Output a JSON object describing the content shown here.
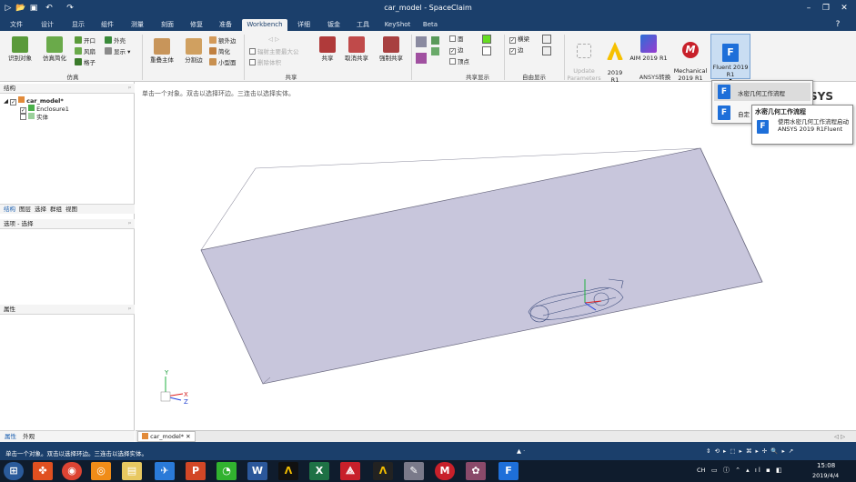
{
  "window": {
    "title": "car_model - SpaceClaim",
    "min": "–",
    "restore": "❐",
    "close": "✕",
    "help": "?"
  },
  "menu": {
    "tabs": [
      "文件",
      "设计",
      "显示",
      "组件",
      "测量",
      "刻面",
      "修复",
      "准备",
      "Workbench",
      "详细",
      "钣金",
      "工具",
      "KeyShot",
      "Beta"
    ],
    "active": "Workbench"
  },
  "ribbon": {
    "sim": {
      "identify": "识别对象",
      "simplify": "仿真简化",
      "opening": "开口",
      "shell": "外壳",
      "wind": "风扇",
      "show": "显示",
      "grid": "格子",
      "group": "仿真"
    },
    "repair": {
      "overlap": "重叠主体",
      "split": "分割边",
      "extra_edge": "额外边",
      "simplify": "简化",
      "small_face": "小型面"
    },
    "share": {
      "auto_share": "辐射主要最大公",
      "delete_body": "删除体积",
      "share": "共享",
      "cancel_share": "取消共享",
      "force_share": "强制共享",
      "group": "共享"
    },
    "share_display": {
      "face": "面",
      "edge": "边",
      "vertex": "顶点",
      "group": "共享显示"
    },
    "free_display": {
      "horizontal": "横梁",
      "edge": "边",
      "group": "自由显示"
    },
    "ansys": {
      "update": "Update\nParameters",
      "r2019": "2019\nR1",
      "aim": "AIM 2019 R1",
      "mechanical": "Mechanical\n2019 R1",
      "fluent": "Fluent 2019\nR1",
      "group": "ANSYS转换",
      "brand": "NSYS"
    }
  },
  "structure": {
    "header": "结构",
    "root": "car_model*",
    "enclosure": "Enclosure1",
    "solid": "实体",
    "tabs": [
      "结构",
      "图层",
      "选择",
      "群组",
      "视图"
    ]
  },
  "options": {
    "header": "选项 - 选择"
  },
  "properties": {
    "header": "属性",
    "tabs": [
      "属性",
      "外观"
    ]
  },
  "viewport": {
    "hint": "单击一个对象。双击以选择环边。三连击以选择实体。"
  },
  "document_tab": {
    "label": "car_model*",
    "close": "✕"
  },
  "status": {
    "text": "单击一个对象。双击以选择环边。三连击以选择实体。"
  },
  "popup": {
    "item1": "水密几何工作流程",
    "item2": "自定"
  },
  "tooltip": {
    "title": "水密几何工作流程",
    "body": "使用水密几何工作流程启动ANSYS 2019 R1Fluent"
  },
  "taskbar": {
    "time": "15:08",
    "date": "2019/4/4",
    "lang": "CH"
  },
  "colors": {
    "titlebar": "#1b3f6b",
    "accent": "#1e6fd9",
    "box_fill": "#c8c6dc",
    "box_edge": "#6b6a80"
  }
}
